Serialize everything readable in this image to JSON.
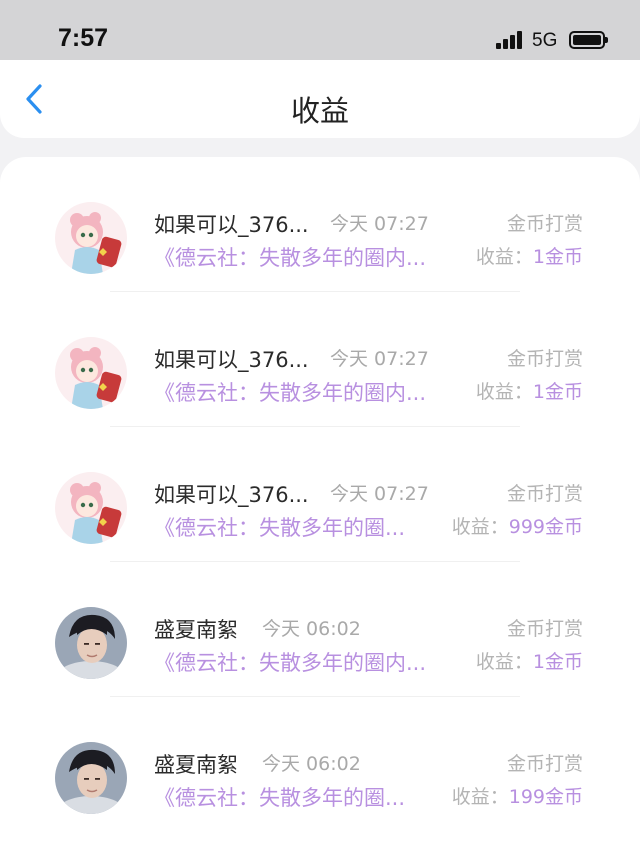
{
  "status_bar": {
    "time": "7:57",
    "network": "5G"
  },
  "nav": {
    "title": "收益"
  },
  "records": [
    {
      "name": "如果可以_376...",
      "time": "今天 07:27",
      "source": "金币打赏",
      "article": "《德云社：失散多年的圈内...",
      "income_label": "收益：",
      "income_value": "1金币",
      "avatar": "anime-girl"
    },
    {
      "name": "如果可以_376...",
      "time": "今天 07:27",
      "source": "金币打赏",
      "article": "《德云社：失散多年的圈内...",
      "income_label": "收益：",
      "income_value": "1金币",
      "avatar": "anime-girl"
    },
    {
      "name": "如果可以_376...",
      "time": "今天 07:27",
      "source": "金币打赏",
      "article": "《德云社：失散多年的圈...",
      "income_label": "收益：",
      "income_value": "999金币",
      "avatar": "anime-girl"
    },
    {
      "name": "盛夏南絮",
      "time": "今天 06:02",
      "source": "金币打赏",
      "article": "《德云社：失散多年的圈内...",
      "income_label": "收益：",
      "income_value": "1金币",
      "avatar": "young-man"
    },
    {
      "name": "盛夏南絮",
      "time": "今天 06:02",
      "source": "金币打赏",
      "article": "《德云社：失散多年的圈...",
      "income_label": "收益：",
      "income_value": "199金币",
      "avatar": "young-man"
    }
  ],
  "colors": {
    "accent_purple": "#b890e0",
    "back_blue": "#2b8ff0"
  }
}
